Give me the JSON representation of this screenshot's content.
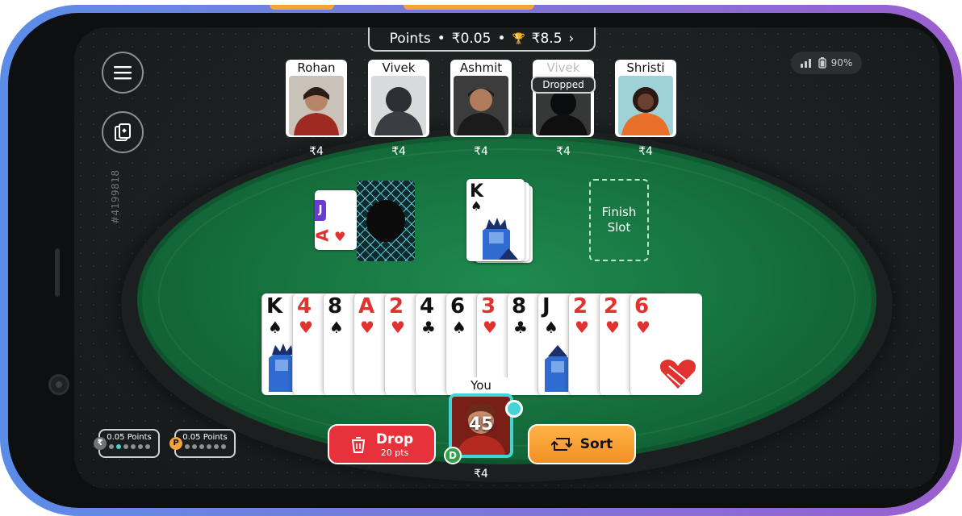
{
  "header": {
    "label": "Points",
    "bullet": "•",
    "entry": "₹0.05",
    "prize": "₹8.5"
  },
  "table_id": "#4199818",
  "status": {
    "battery": "90%",
    "network": "4G"
  },
  "players": [
    {
      "name": "Rohan",
      "amount": "₹4",
      "dropped": false,
      "photo_color": "#9e2a22"
    },
    {
      "name": "Vivek",
      "amount": "₹4",
      "dropped": false,
      "photo_color": "#3a3d42"
    },
    {
      "name": "Ashmit",
      "amount": "₹4",
      "dropped": false,
      "photo_color": "#2a2a2a"
    },
    {
      "name": "Vivek",
      "amount": "₹4",
      "dropped": true,
      "status": "Dropped",
      "photo_color": "#3a3d42"
    },
    {
      "name": "Shristi",
      "amount": "₹4",
      "dropped": false,
      "photo_color": "#e8702a"
    }
  ],
  "discard_pile": {
    "top_rank": "A",
    "top_suit": "♥",
    "under_rank": "J"
  },
  "open_card": {
    "rank": "K",
    "suit": "♠"
  },
  "finish_slot": {
    "line1": "Finish",
    "line2": "Slot"
  },
  "hand": [
    {
      "rank": "K",
      "suit": "♠",
      "color": "black"
    },
    {
      "rank": "4",
      "suit": "♥",
      "color": "red"
    },
    {
      "rank": "8",
      "suit": "♠",
      "color": "black"
    },
    {
      "rank": "A",
      "suit": "♥",
      "color": "red"
    },
    {
      "rank": "2",
      "suit": "♥",
      "color": "red"
    },
    {
      "rank": "4",
      "suit": "♣",
      "color": "black"
    },
    {
      "rank": "6",
      "suit": "♠",
      "color": "black"
    },
    {
      "rank": "3",
      "suit": "♥",
      "color": "red"
    },
    {
      "rank": "8",
      "suit": "♣",
      "color": "black"
    },
    {
      "rank": "J",
      "suit": "♠",
      "color": "black"
    },
    {
      "rank": "2",
      "suit": "♥",
      "color": "red"
    },
    {
      "rank": "2",
      "suit": "♥",
      "color": "red"
    },
    {
      "rank": "6",
      "suit": "♥",
      "color": "red"
    }
  ],
  "you": {
    "name": "You",
    "timer": "45",
    "amount": "₹4",
    "dealer": "D"
  },
  "drop_button": {
    "label": "Drop",
    "sub": "20 pts"
  },
  "sort_button": {
    "label": "Sort"
  },
  "mini_tables": [
    {
      "label": "0.05 Points",
      "currency": "₹"
    },
    {
      "label": "0.05 Points",
      "currency": "P"
    }
  ]
}
